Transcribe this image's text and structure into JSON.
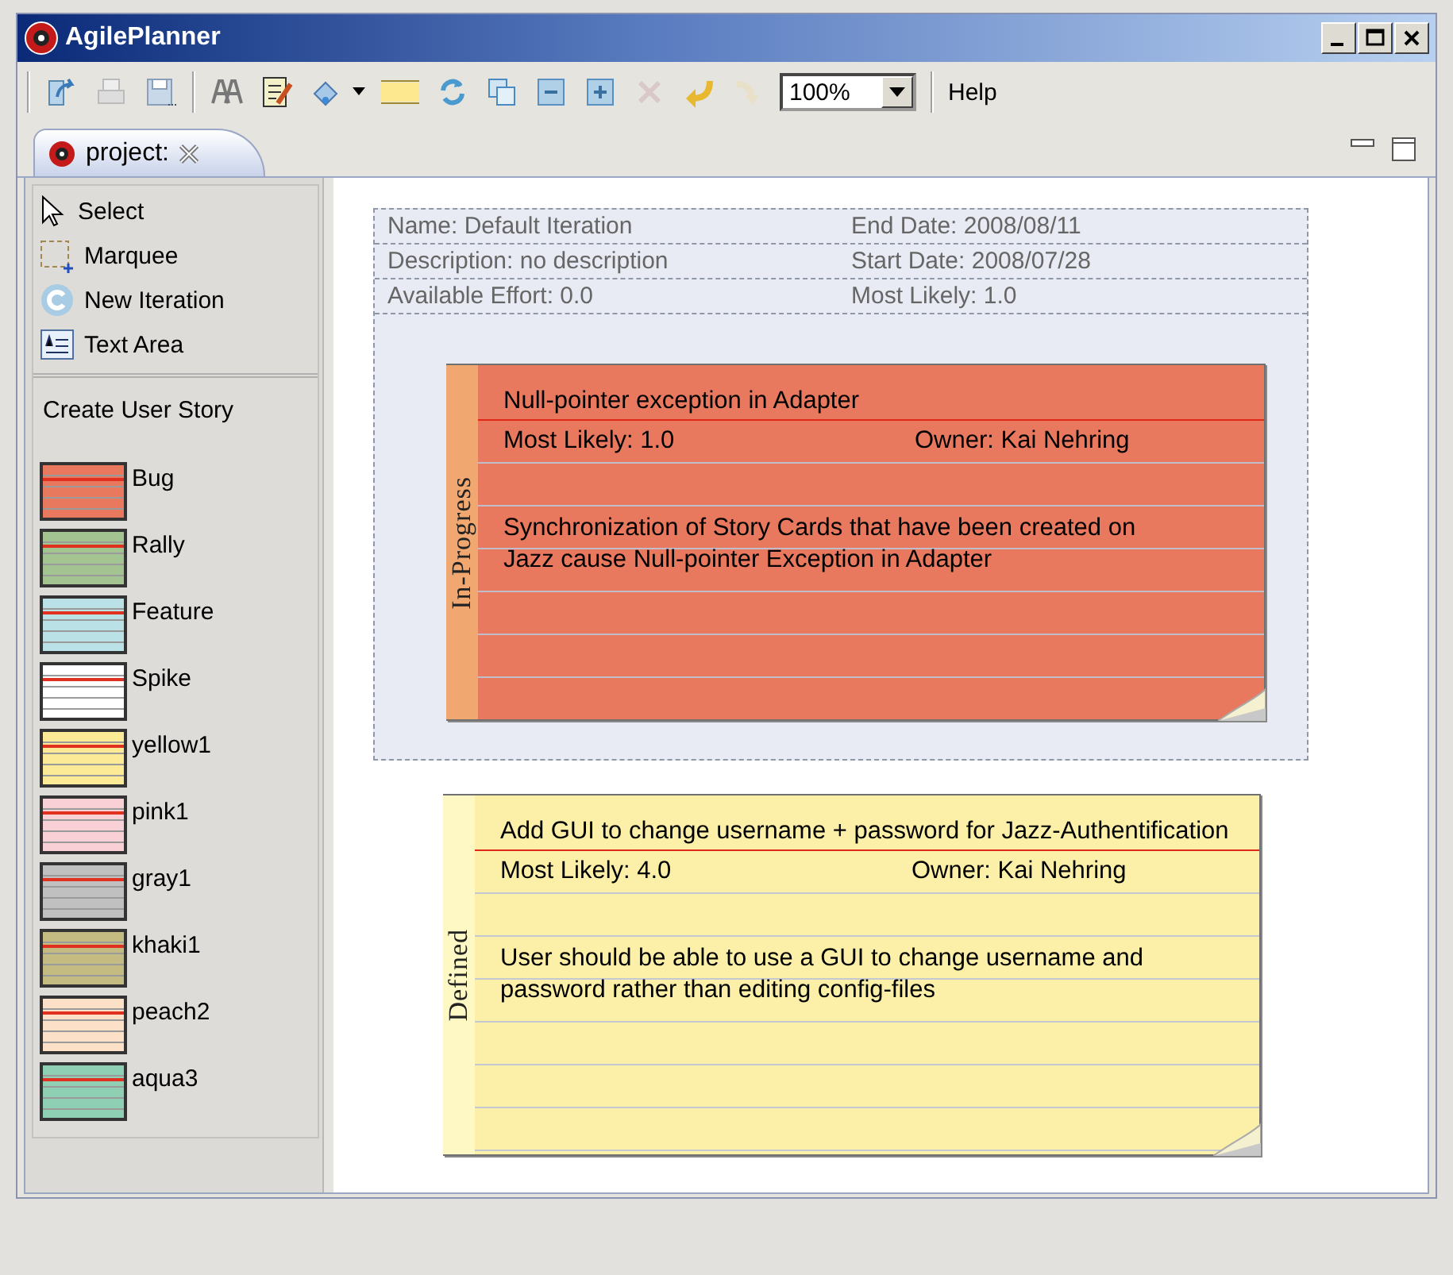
{
  "window": {
    "title": "AgilePlanner"
  },
  "toolbar": {
    "zoom": "100%",
    "menu": "Help"
  },
  "editor_tab": {
    "label": "project:"
  },
  "palette": {
    "tools": [
      {
        "label": "Select"
      },
      {
        "label": "Marquee"
      },
      {
        "label": "New Iteration"
      },
      {
        "label": "Text Area"
      }
    ],
    "section": "Create User Story",
    "story_types": [
      {
        "label": "Bug",
        "color": "#e8795f"
      },
      {
        "label": "Rally",
        "color": "#a3c491"
      },
      {
        "label": "Feature",
        "color": "#b9e1e6"
      },
      {
        "label": "Spike",
        "color": "#ffffff"
      },
      {
        "label": "yellow1",
        "color": "#fdea96"
      },
      {
        "label": "pink1",
        "color": "#f8d0d6"
      },
      {
        "label": "gray1",
        "color": "#c0c0c0"
      },
      {
        "label": "khaki1",
        "color": "#c4bb82"
      },
      {
        "label": "peach2",
        "color": "#fde0c8"
      },
      {
        "label": "aqua3",
        "color": "#8fd0b4"
      }
    ]
  },
  "iteration": {
    "rows": [
      [
        "Name: Default Iteration",
        "End Date: 2008/08/11"
      ],
      [
        "Description: no description",
        "Start Date: 2008/07/28"
      ],
      [
        "Available Effort: 0.0",
        "Most Likely: 1.0"
      ]
    ],
    "cards": [
      {
        "status": "In-Progress",
        "title": "Null-pointer exception in Adapter",
        "most_likely_label": "Most Likely:",
        "most_likely": "1.0",
        "owner_label": "Owner:",
        "owner": "Kai Nehring",
        "description": "Synchronization of Story Cards that have been created on Jazz cause Null-pointer Exception in Adapter",
        "color": "#e8795f",
        "band": {
          "color": "#f0a870"
        }
      }
    ]
  },
  "cards": [
    {
      "status": "Defined",
      "title": "Add GUI to change username + password for Jazz-Authentification",
      "most_likely_label": "Most Likely:",
      "most_likely": "4.0",
      "owner_label": "Owner:",
      "owner": "Kai Nehring",
      "description": "User should be able to use a GUI to change username and password rather than editing config-files",
      "color": "#fcf0a8",
      "band": {
        "color": "#fdf8c4"
      }
    }
  ]
}
